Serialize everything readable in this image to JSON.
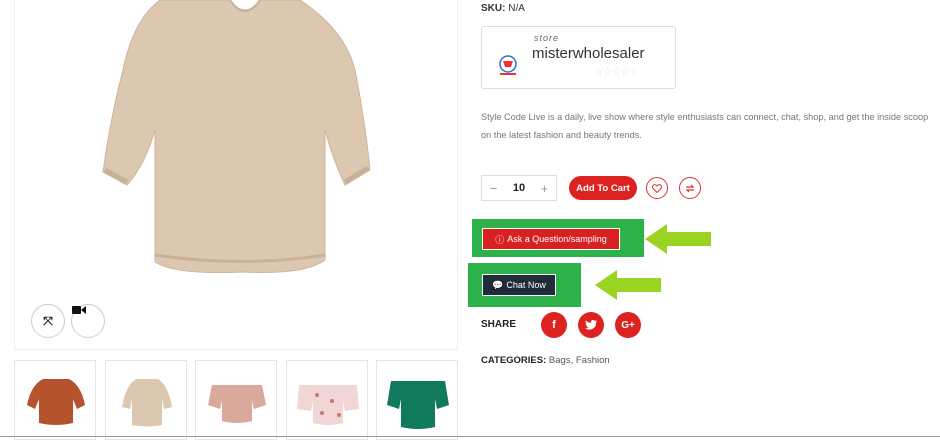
{
  "product": {
    "sku_label": "SKU:",
    "sku_value": "N/A",
    "description": "Style Code Live is a daily, live show where style enthusiasts can connect, chat, shop, and get the inside scoop on the latest fashion and beauty trends.",
    "quantity": "10",
    "qty_minus": "−",
    "qty_plus": "+"
  },
  "store": {
    "label": "store",
    "name": "misterwholesaler",
    "stars": "☆☆☆☆☆",
    "rating": 0
  },
  "buttons": {
    "add_to_cart": "Add To Cart",
    "ask_question": "Ask a Question/sampling",
    "chat_now": "Chat Now"
  },
  "share": {
    "label": "SHARE",
    "networks": [
      "f",
      "t",
      "G+"
    ]
  },
  "categories": {
    "label": "CATEGORIES:",
    "items": [
      "Bags",
      "Fashion"
    ]
  },
  "icons": {
    "expand": "expand-icon",
    "video": "video-icon",
    "wishlist": "heart-icon",
    "compare": "compare-icon",
    "question": "question-icon",
    "chat": "chat-bubble-icon"
  },
  "colors": {
    "brand_red": "#d22222",
    "highlight_green": "#2db24b",
    "arrow_lime": "#9bd322",
    "chat_dark": "#1f2d3a"
  }
}
